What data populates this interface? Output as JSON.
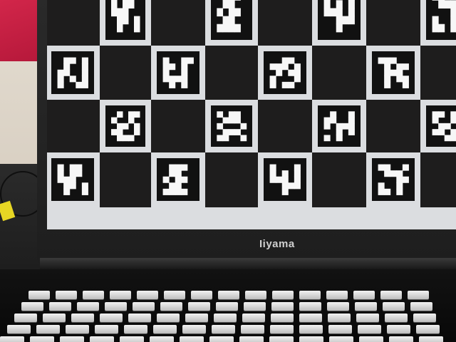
{
  "laptop": {
    "brand": "Iiyama"
  },
  "board": {
    "cell_light": "#dbdde0",
    "cell_dark": "#1e1d1d",
    "marker_dark": "#111111",
    "marker_light": "#f7f7f7"
  }
}
